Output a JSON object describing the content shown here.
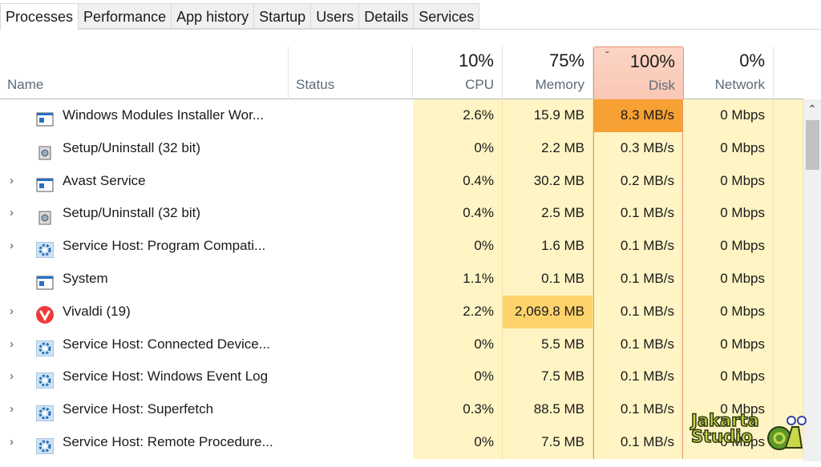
{
  "tabs": [
    "Processes",
    "Performance",
    "App history",
    "Startup",
    "Users",
    "Details",
    "Services"
  ],
  "columns": {
    "name": "Name",
    "status": "Status",
    "cpu": {
      "pct": "10%",
      "label": "CPU"
    },
    "memory": {
      "pct": "75%",
      "label": "Memory"
    },
    "disk": {
      "pct": "100%",
      "label": "Disk",
      "sorted": "descending"
    },
    "network": {
      "pct": "0%",
      "label": "Network"
    }
  },
  "rows": [
    {
      "name": "Windows Modules Installer Wor...",
      "icon": "window-icon",
      "expand": false,
      "cpu": "2.6%",
      "memory": "15.9 MB",
      "disk": "8.3 MB/s",
      "network": "0 Mbps"
    },
    {
      "name": "Setup/Uninstall (32 bit)",
      "icon": "installer-icon",
      "expand": false,
      "cpu": "0%",
      "memory": "2.2 MB",
      "disk": "0.3 MB/s",
      "network": "0 Mbps"
    },
    {
      "name": "Avast Service",
      "icon": "window-icon",
      "expand": true,
      "cpu": "0.4%",
      "memory": "30.2 MB",
      "disk": "0.2 MB/s",
      "network": "0 Mbps"
    },
    {
      "name": "Setup/Uninstall (32 bit)",
      "icon": "installer-icon",
      "expand": true,
      "cpu": "0.4%",
      "memory": "2.5 MB",
      "disk": "0.1 MB/s",
      "network": "0 Mbps"
    },
    {
      "name": "Service Host: Program Compati...",
      "icon": "gear-icon",
      "expand": true,
      "cpu": "0%",
      "memory": "1.6 MB",
      "disk": "0.1 MB/s",
      "network": "0 Mbps"
    },
    {
      "name": "System",
      "icon": "window-icon",
      "expand": false,
      "cpu": "1.1%",
      "memory": "0.1 MB",
      "disk": "0.1 MB/s",
      "network": "0 Mbps"
    },
    {
      "name": "Vivaldi (19)",
      "icon": "vivaldi-icon",
      "expand": true,
      "cpu": "2.2%",
      "memory": "2,069.8 MB",
      "disk": "0.1 MB/s",
      "network": "0 Mbps"
    },
    {
      "name": "Service Host: Connected Device...",
      "icon": "gear-icon",
      "expand": true,
      "cpu": "0%",
      "memory": "5.5 MB",
      "disk": "0.1 MB/s",
      "network": "0 Mbps"
    },
    {
      "name": "Service Host: Windows Event Log",
      "icon": "gear-icon",
      "expand": true,
      "cpu": "0%",
      "memory": "7.5 MB",
      "disk": "0.1 MB/s",
      "network": "0 Mbps"
    },
    {
      "name": "Service Host: Superfetch",
      "icon": "gear-icon",
      "expand": true,
      "cpu": "0.3%",
      "memory": "88.5 MB",
      "disk": "0.1 MB/s",
      "network": "0 Mbps"
    },
    {
      "name": "Service Host: Remote Procedure...",
      "icon": "gear-icon",
      "expand": true,
      "cpu": "0%",
      "memory": "7.5 MB",
      "disk": "0.1 MB/s",
      "network": "0 Mbps"
    }
  ],
  "colors": {
    "disk_hot": "#f7a033",
    "memory_warm": "#ffd36b",
    "cell": "#fff4c4",
    "disk_header": "#fcd5c5"
  },
  "watermark": {
    "line1": "Jakarta",
    "line2": "Studio"
  }
}
